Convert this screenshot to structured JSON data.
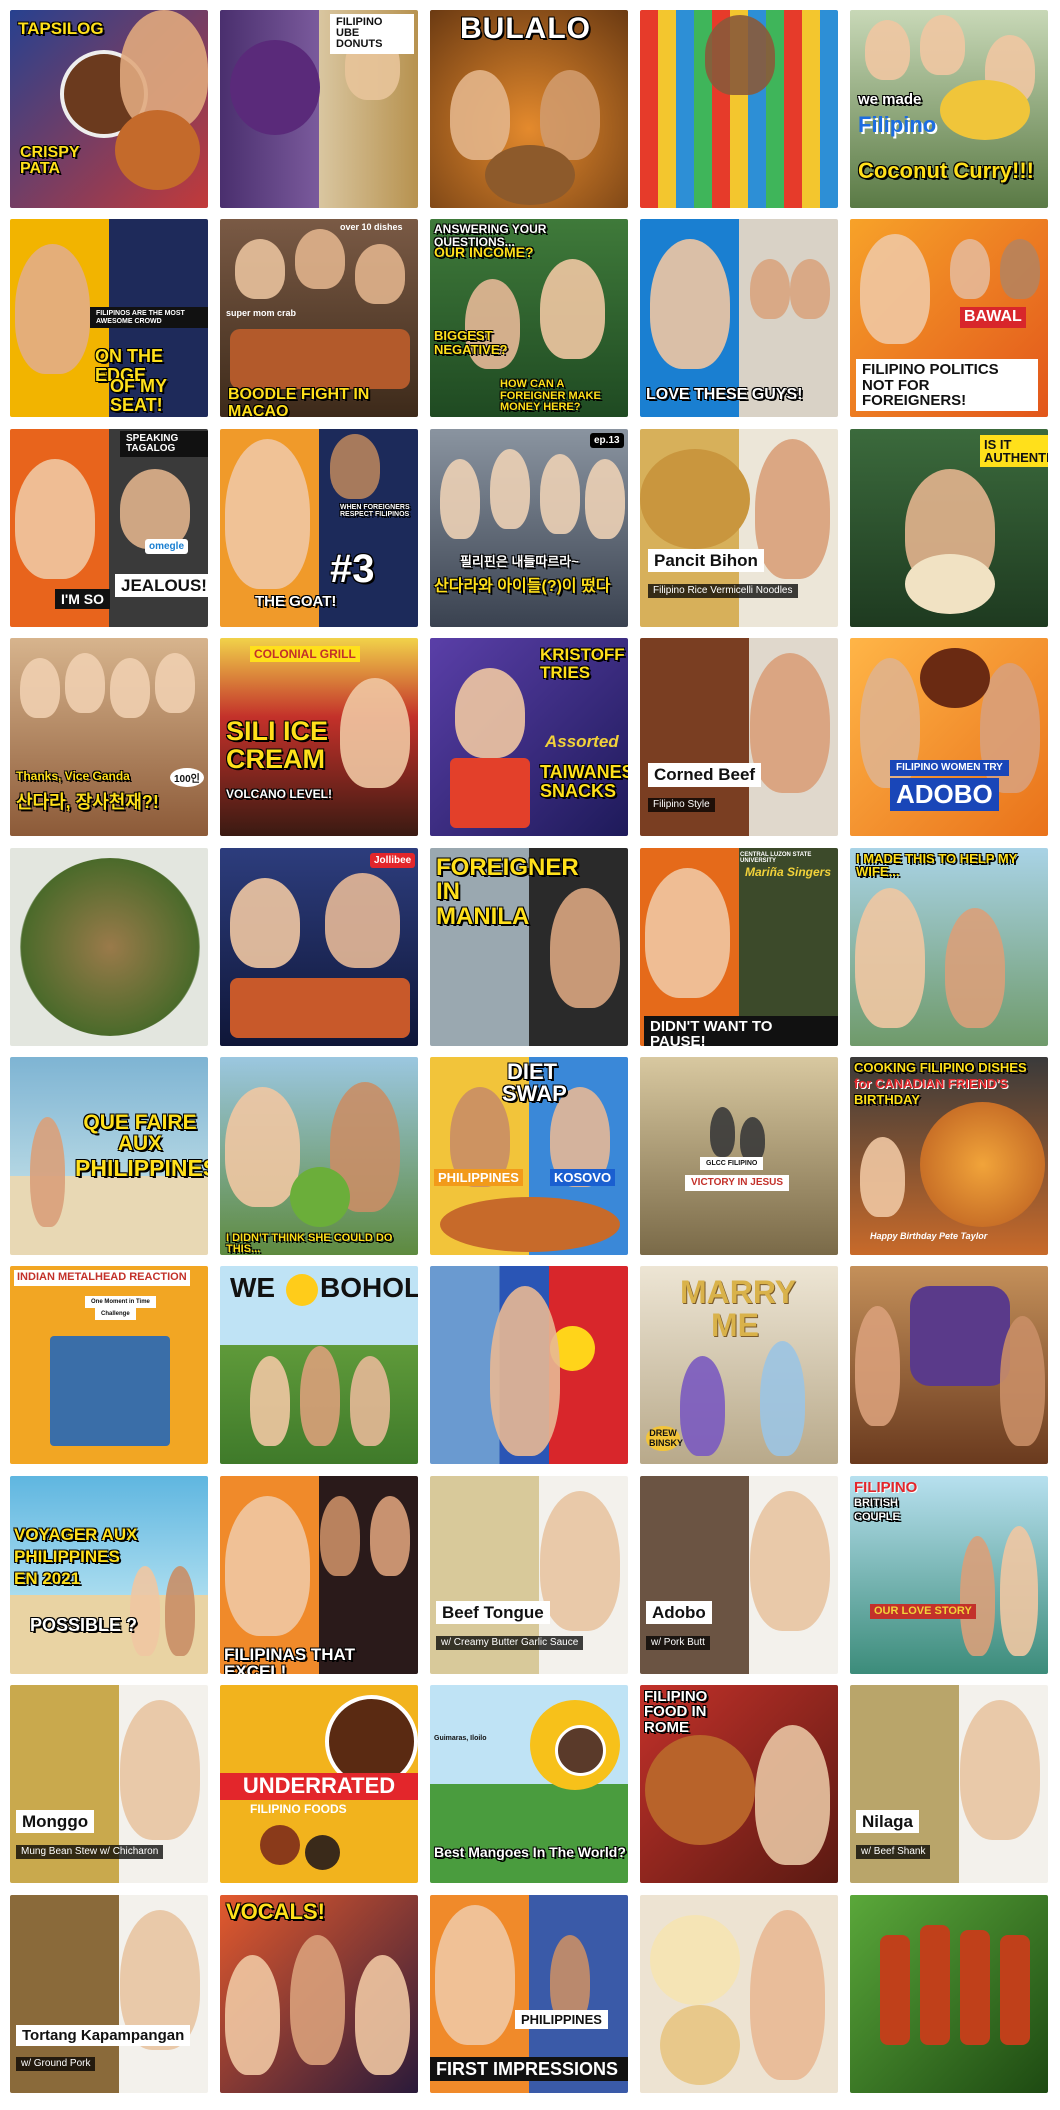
{
  "thumbnails": [
    {
      "texts": [
        "TAPSILOG",
        "CRISPY PATA"
      ],
      "bg": "#2a3f8e"
    },
    {
      "texts": [
        "FILIPINO UBE DONUTS"
      ],
      "bg": "#6b4f8a"
    },
    {
      "texts": [
        "BULALO"
      ],
      "bg": "#c9742b"
    },
    {
      "texts": [],
      "bg": "#e9c235"
    },
    {
      "texts": [
        "we made",
        "Filipino",
        "Coconut Curry!!!"
      ],
      "bg": "#6d8b4e"
    },
    {
      "texts": [
        "ON THE EDGE",
        "OF MY SEAT!",
        "FILIPINOS ARE THE MOST AWESOME CROWD"
      ],
      "bg": "#f2b400"
    },
    {
      "texts": [
        "BOODLE FIGHT IN MACAO",
        "super mom crab",
        "over 10 dishes"
      ],
      "bg": "#8a5a3c"
    },
    {
      "texts": [
        "ANSWERING YOUR QUESTIONS...",
        "OUR INCOME?",
        "BIGGEST NEGATIVE?",
        "HOW CAN A FOREIGNER MAKE MONEY HERE?"
      ],
      "bg": "#2f6b3c"
    },
    {
      "texts": [
        "LOVE THESE GUYS!"
      ],
      "bg": "#1a7fd1"
    },
    {
      "texts": [
        "BAWAL",
        "FILIPINO POLITICS NOT FOR FOREIGNERS!"
      ],
      "bg": "#f07d1a"
    },
    {
      "texts": [
        "SPEAKING TAGALOG",
        "I'M SO",
        "JEALOUS!",
        "omegle"
      ],
      "bg": "#e8641c"
    },
    {
      "texts": [
        "THE GOAT!",
        "#3",
        "WHEN FOREIGNERS RESPECT FILIPINOS"
      ],
      "bg": "#e3581d"
    },
    {
      "texts": [
        "필리핀은 내들따르라~",
        "산다라와 아이들(?)이 떴다",
        "ep.13"
      ],
      "bg": "#4e5a6b"
    },
    {
      "texts": [
        "Pancit Bihon",
        "Filipino Rice Vermicelli Noodles"
      ],
      "bg": "#d9b45a"
    },
    {
      "texts": [
        "IS IT AUTHENTIC?"
      ],
      "bg": "#2d5a34"
    },
    {
      "texts": [
        "Thanks, Vice Ganda",
        "산다라, 장사천재?!",
        "100인"
      ],
      "bg": "#b9865e"
    },
    {
      "texts": [
        "COLONIAL GRILL",
        "SILI ICE CREAM",
        "VOLCANO LEVEL!"
      ],
      "bg": "#c3312a"
    },
    {
      "texts": [
        "KRISTOFF TRIES",
        "Assorted",
        "TAIWANESE SNACKS"
      ],
      "bg": "#3e2f8a"
    },
    {
      "texts": [
        "Corned Beef",
        "Filipino Style"
      ],
      "bg": "#7a3e22"
    },
    {
      "texts": [
        "FILIPINO WOMEN TRY",
        "ADOBO"
      ],
      "bg": "#f29a37"
    },
    {
      "texts": [],
      "bg": "#dfe4da"
    },
    {
      "texts": [
        "Jollibee"
      ],
      "bg": "#2d3d7d"
    },
    {
      "texts": [
        "FOREIGNER IN MANILA"
      ],
      "bg": "#a53b24"
    },
    {
      "texts": [
        "DIDN'T WANT TO PAUSE!",
        "CENTRAL LUZON STATE UNIVERSITY",
        "Mariña Singers"
      ],
      "bg": "#e56a1a"
    },
    {
      "texts": [
        "I MADE THIS TO HELP MY WIFE..."
      ],
      "bg": "#6f9a6a"
    },
    {
      "texts": [
        "QUE FAIRE AUX",
        "PHILIPPINES"
      ],
      "bg": "#7eaec9"
    },
    {
      "texts": [
        "I DIDN'T THINK SHE COULD DO THIS..."
      ],
      "bg": "#5e8a3f"
    },
    {
      "texts": [
        "DIET SWAP",
        "PHILIPPINES",
        "KOSOVO"
      ],
      "bg": "#f2b92a"
    },
    {
      "texts": [
        "GLCC FILIPINO",
        "VICTORY IN JESUS"
      ],
      "bg": "#cbb790"
    },
    {
      "texts": [
        "COOKING FILIPINO DISHES",
        "for CANADIAN FRIEND'S",
        "BIRTHDAY",
        "Happy Birthday Pete Taylor"
      ],
      "bg": "#c86a2a"
    },
    {
      "texts": [
        "INDIAN METALHEAD REACTION",
        "One Moment in Time",
        "Challenge"
      ],
      "bg": "#f2a623"
    },
    {
      "texts": [
        "WE",
        "BOHOL"
      ],
      "bg": "#3d8fd0"
    },
    {
      "texts": [],
      "bg": "#2a55b5"
    },
    {
      "texts": [
        "MARRY ME",
        "DREW BINSKY"
      ],
      "bg": "#e2d6c2"
    },
    {
      "texts": [],
      "bg": "#b58257"
    },
    {
      "texts": [
        "VOYAGER AUX",
        "PHILIPPINES",
        "EN 2021",
        "POSSIBLE ?"
      ],
      "bg": "#5fb6e0"
    },
    {
      "texts": [
        "FILIPINAS THAT EXCEL!"
      ],
      "bg": "#e8511e"
    },
    {
      "texts": [
        "Beef Tongue",
        "w/ Creamy Butter Garlic Sauce"
      ],
      "bg": "#d8c99a"
    },
    {
      "texts": [
        "Adobo",
        "w/ Pork Butt"
      ],
      "bg": "#6b5443"
    },
    {
      "texts": [
        "FILIPINO",
        "BRITISH",
        "COUPLE",
        "OUR LOVE STORY"
      ],
      "bg": "#3c8c7a"
    },
    {
      "texts": [
        "Monggo",
        "Mung Bean Stew w/ Chicharon"
      ],
      "bg": "#c9a94d"
    },
    {
      "texts": [
        "UNDERRATED",
        "FILIPINO FOODS"
      ],
      "bg": "#f2b31d"
    },
    {
      "texts": [
        "Guimaras, Iloilo",
        "Best Mangoes In The World?"
      ],
      "bg": "#4a9c3e"
    },
    {
      "texts": [
        "FILIPINO FOOD IN ROME"
      ],
      "bg": "#b8321f"
    },
    {
      "texts": [
        "Nilaga",
        "w/ Beef Shank"
      ],
      "bg": "#b9a56a"
    },
    {
      "texts": [
        "Tortang Kapampangan",
        "w/ Ground Pork"
      ],
      "bg": "#8a6a3a"
    },
    {
      "texts": [
        "VOCALS!"
      ],
      "bg": "#c43d2d"
    },
    {
      "texts": [
        "PHILIPPINES",
        "FIRST IMPRESSIONS"
      ],
      "bg": "#d84a1e"
    },
    {
      "texts": [],
      "bg": "#e9ddc9"
    },
    {
      "texts": [],
      "bg": "#3e7a2c"
    }
  ]
}
